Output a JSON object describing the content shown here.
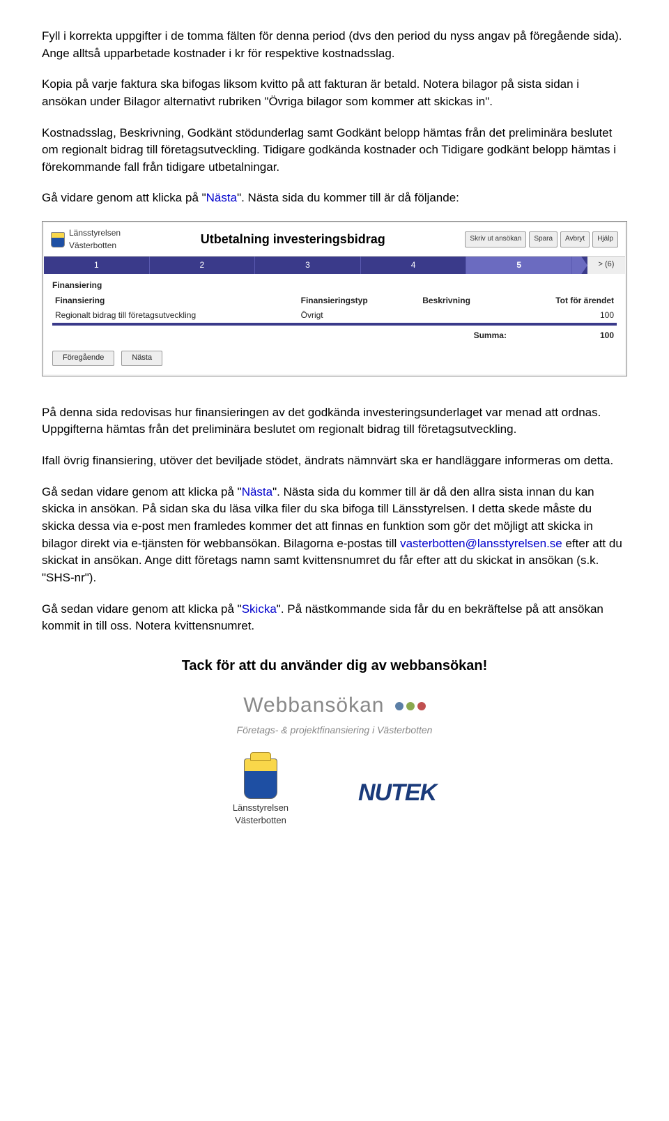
{
  "para1": "Fyll i korrekta uppgifter i de tomma fälten för denna period (dvs den period du nyss angav på föregående sida). Ange alltså upparbetade kostnader i kr för respektive kostnadsslag.",
  "para2": "Kopia på varje faktura ska bifogas liksom kvitto på att fakturan är betald. Notera bilagor på sista sidan i ansökan under Bilagor alternativt rubriken \"Övriga bilagor som kommer att skickas in\".",
  "para3": "Kostnadsslag, Beskrivning, Godkänt stödunderlag samt Godkänt belopp hämtas från det preliminära beslutet om regionalt bidrag till företagsutveckling. Tidigare godkända kostnader och Tidigare godkänt belopp hämtas i förekommande fall från tidigare utbetalningar.",
  "para4_a": "Gå vidare genom att klicka på \"",
  "para4_link": "Nästa",
  "para4_b": "\". Nästa sida du kommer till är då följande:",
  "para5": "På denna sida redovisas hur finansieringen av det godkända investeringsunderlaget var menad att ordnas. Uppgifterna hämtas från det preliminära beslutet om regionalt bidrag till företagsutveckling.",
  "para6": "Ifall övrig finansiering, utöver det beviljade stödet, ändrats nämnvärt ska er handläggare informeras om detta.",
  "para7_a": "Gå sedan vidare genom att klicka på \"",
  "para7_link": "Nästa",
  "para7_b": "\". Nästa sida du kommer till är då den allra sista innan du kan skicka in ansökan. På sidan ska du läsa vilka filer du ska bifoga till Länsstyrelsen. I detta skede måste du skicka dessa via e-post men framledes kommer det att finnas en funktion som gör det möjligt att skicka in bilagor direkt via e-tjänsten för webbansökan. Bilagorna e-postas till ",
  "para7_email": "vasterbotten@lansstyrelsen.se",
  "para7_c": " efter att du skickat in ansökan. Ange ditt företags namn samt kvittensnumret du får efter att du skickat in ansökan (s.k. \"SHS-nr\").",
  "para8_a": "Gå sedan vidare genom att klicka på \"",
  "para8_link": "Skicka",
  "para8_b": "\". På nästkommande sida får du en bekräftelse på att ansökan kommit in till oss. Notera kvittensnumret.",
  "thanks": "Tack för att du använder dig av webbansökan!",
  "shot": {
    "org1": "Länsstyrelsen",
    "org2": "Västerbotten",
    "title": "Utbetalning investeringsbidrag",
    "btn_print": "Skriv ut ansökan",
    "btn_save": "Spara",
    "btn_cancel": "Avbryt",
    "btn_help": "Hjälp",
    "steps": [
      "1",
      "2",
      "3",
      "4",
      "5"
    ],
    "step_end": "> (6)",
    "section": "Finansiering",
    "h1": "Finansiering",
    "h2": "Finansieringstyp",
    "h3": "Beskrivning",
    "h4": "Tot för ärendet",
    "row_fin": "Regionalt bidrag till företagsutveckling",
    "row_type": "Övrigt",
    "row_desc": "",
    "row_tot": "100",
    "sum_lbl": "Summa:",
    "sum_val": "100",
    "prev": "Föregående",
    "next": "Nästa"
  },
  "footer": {
    "webb": "Webbansökan",
    "sub": "Företags- & projektfinansiering i Västerbotten",
    "lans1": "Länsstyrelsen",
    "lans2": "Västerbotten",
    "nutek": "NUTEK"
  }
}
